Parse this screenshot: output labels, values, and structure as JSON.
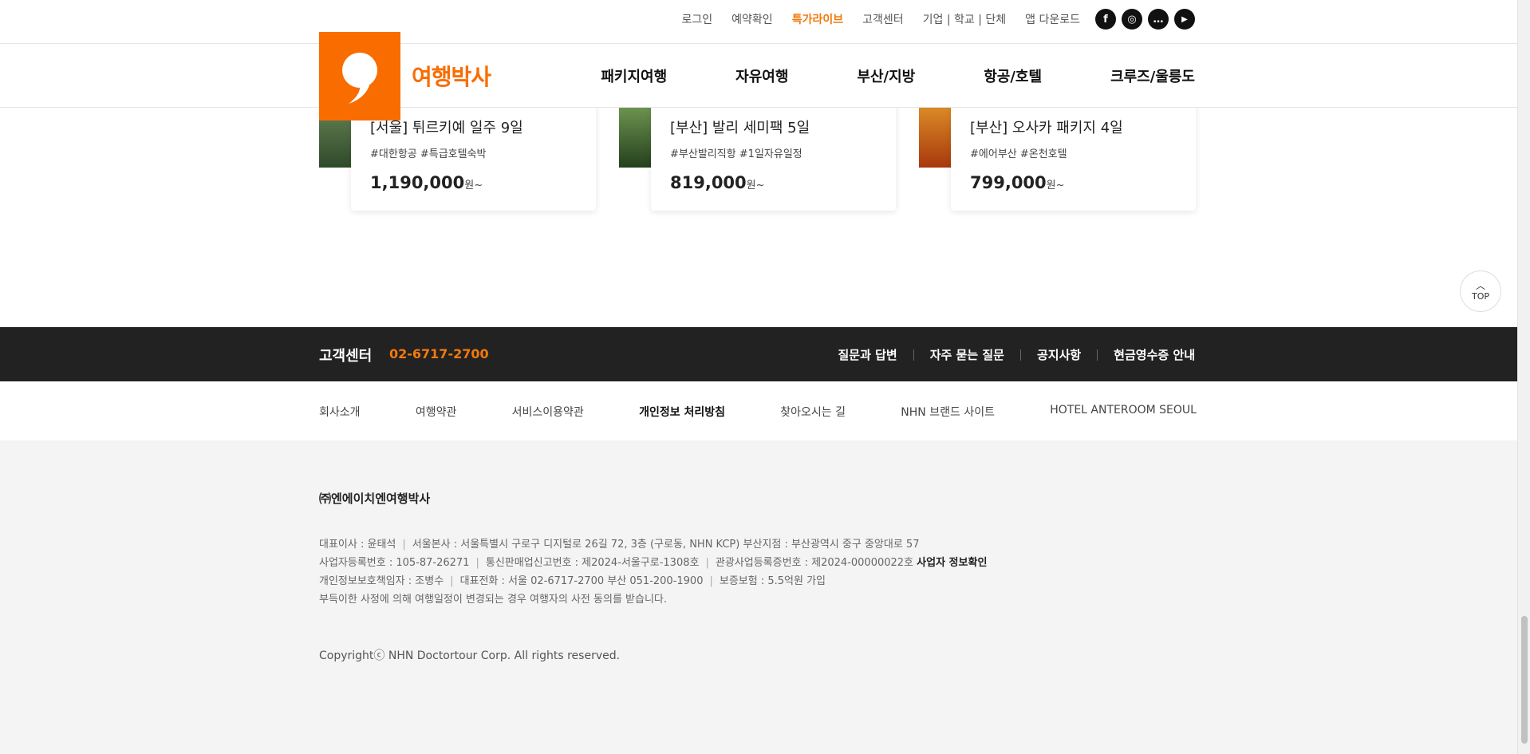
{
  "header": {
    "util_links": [
      {
        "label": "로그인",
        "hot": false
      },
      {
        "label": "예약확인",
        "hot": false
      },
      {
        "label": "특가라이브",
        "hot": true
      },
      {
        "label": "고객센터",
        "hot": false
      },
      {
        "label": "기업 | 학교 | 단체",
        "hot": false
      },
      {
        "label": "앱 다운로드",
        "hot": false
      }
    ],
    "social": [
      {
        "icon": "facebook-icon",
        "glyph": "f"
      },
      {
        "icon": "instagram-icon",
        "glyph": "◎"
      },
      {
        "icon": "kakaotalk-icon",
        "glyph": "…"
      },
      {
        "icon": "youtube-icon",
        "glyph": "▶"
      }
    ],
    "logo_text": "여행박사",
    "nav": [
      "패키지여행",
      "자유여행",
      "부산/지방",
      "항공/호텔",
      "크루즈/울릉도"
    ]
  },
  "cards": [
    {
      "title": "[서울] 튀르키예 일주 9일",
      "tags": "#대한항공 #특급호텔숙박",
      "price": "1,190,000",
      "unit": "원~",
      "thumb_color": "#3e5a3a"
    },
    {
      "title": "[부산] 발리 세미팩 5일",
      "tags": "#부산발리직항 #1일자유일정",
      "price": "819,000",
      "unit": "원~",
      "thumb_color": "#3f6b2e"
    },
    {
      "title": "[부산] 오사카 패키지 4일",
      "tags": "#에어부산 #온천호텔",
      "price": "799,000",
      "unit": "원~",
      "thumb_color": "#c25a12"
    }
  ],
  "top_button": {
    "label": "TOP"
  },
  "customer_center": {
    "title": "고객센터",
    "phone": "02-6717-2700",
    "links": [
      "질문과 답변",
      "자주 묻는 질문",
      "공지사항",
      "현금영수증 안내"
    ]
  },
  "footer_links": [
    {
      "label": "회사소개",
      "strong": false
    },
    {
      "label": "여행약관",
      "strong": false
    },
    {
      "label": "서비스이용약관",
      "strong": false
    },
    {
      "label": "개인정보 처리방침",
      "strong": true
    },
    {
      "label": "찾아오시는 길",
      "strong": false
    },
    {
      "label": "NHN 브랜드 사이트",
      "strong": false
    },
    {
      "label": "HOTEL ANTEROOM SEOUL",
      "strong": false
    }
  ],
  "company": {
    "name": "㈜엔에이치엔여행박사",
    "line1": [
      "대표이사 : 윤태석",
      "서울본사 : 서울특별시 구로구 디지털로 26길 72, 3층 (구로동, NHN KCP) 부산지점 : 부산광역시 중구 중앙대로 57"
    ],
    "line2": [
      "사업자등록번호 : 105-87-26271",
      "통신판매업신고번호 : 제2024-서울구로-1308호",
      "관광사업등록증번호 : 제2024-00000022호"
    ],
    "line2_link": "사업자 정보확인",
    "line3": [
      "개인정보보호책임자 : 조병수",
      "대표전화 : 서울 02-6717-2700 부산 051-200-1900",
      "보증보험 : 5.5억원 가입"
    ],
    "line4": "부득이한 사정에 의해 여행일정이 변경되는 경우 여행자의 사전 동의를 받습니다.",
    "copyright": "Copyrightⓒ NHN Doctortour Corp. All rights reserved."
  },
  "colors": {
    "accent": "#f96d00",
    "hot": "#f27a0c",
    "dark_bar": "#222222"
  }
}
